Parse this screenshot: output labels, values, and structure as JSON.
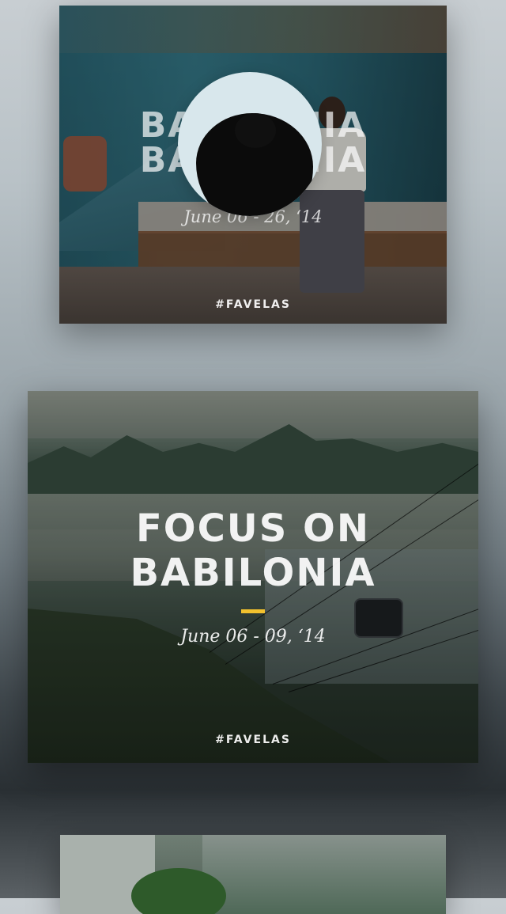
{
  "feed": {
    "cards": [
      {
        "title_line1": "BABILONIA",
        "title_line2": "BABILONIA",
        "date": "June 06 - 26, ‘14",
        "tag": "#FAVELAS"
      },
      {
        "title_line1": "FOCUS ON",
        "title_line2": "BABILONIA",
        "date": "June 06 - 09, ‘14",
        "tag": "#FAVELAS"
      }
    ]
  },
  "avatar": {
    "icon": "user-avatar-silhouette"
  },
  "colors": {
    "accent": "#f2c12e",
    "avatar_bg": "#d8e7ec"
  }
}
